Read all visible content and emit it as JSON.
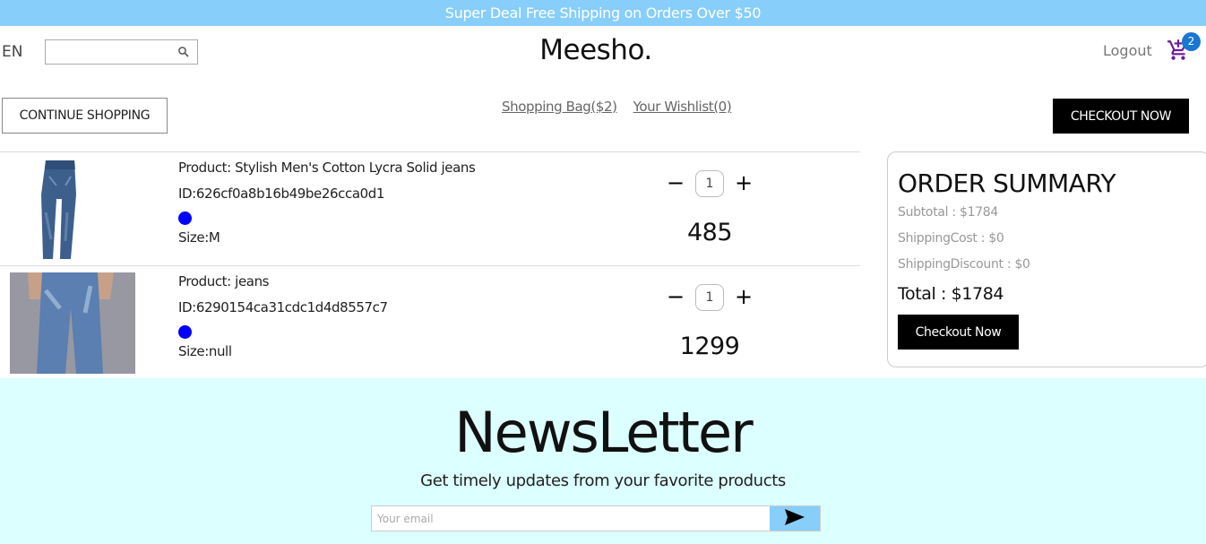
{
  "announcement": "Super Deal Free Shipping on Orders Over $50",
  "header": {
    "language": "EN",
    "search_placeholder": "",
    "logo": "Meesho.",
    "logout": "Logout",
    "cart_count": "2"
  },
  "actions": {
    "continue_shopping": "CONTINUE SHOPPING",
    "shopping_bag": "Shopping Bag($2)",
    "wishlist": "Your Wishlist(0)",
    "checkout_now": "CHECKOUT NOW"
  },
  "cart_items": [
    {
      "product": "Product: Stylish Men's Cotton Lycra Solid jeans",
      "id": "ID:626cf0a8b16b49be26cca0d1",
      "color": "#0000ff",
      "size": "Size:M",
      "quantity": "1",
      "price": "485",
      "image": "jeans-product-image"
    },
    {
      "product": "Product: jeans",
      "id": "ID:6290154ca31cdc1d4d8557c7",
      "color": "#0000ff",
      "size": "Size:null",
      "quantity": "1",
      "price": "1299",
      "image": "jeans-product-image"
    }
  ],
  "summary": {
    "title": "ORDER SUMMARY",
    "subtotal": "Subtotal : $1784",
    "shipping_cost": "ShippingCost : $0",
    "shipping_discount": "ShippingDiscount : $0",
    "total": "Total : $1784",
    "checkout_button": "Checkout Now"
  },
  "newsletter": {
    "title": "NewsLetter",
    "subtitle": "Get timely updates from your favorite products",
    "email_placeholder": "Your email",
    "send_icon": "send-icon"
  },
  "colors": {
    "announcement_bg": "#87cefa",
    "newsletter_bg": "#dcffff",
    "badge": "#1976d2",
    "cart_icon": "#6a1b9a"
  }
}
